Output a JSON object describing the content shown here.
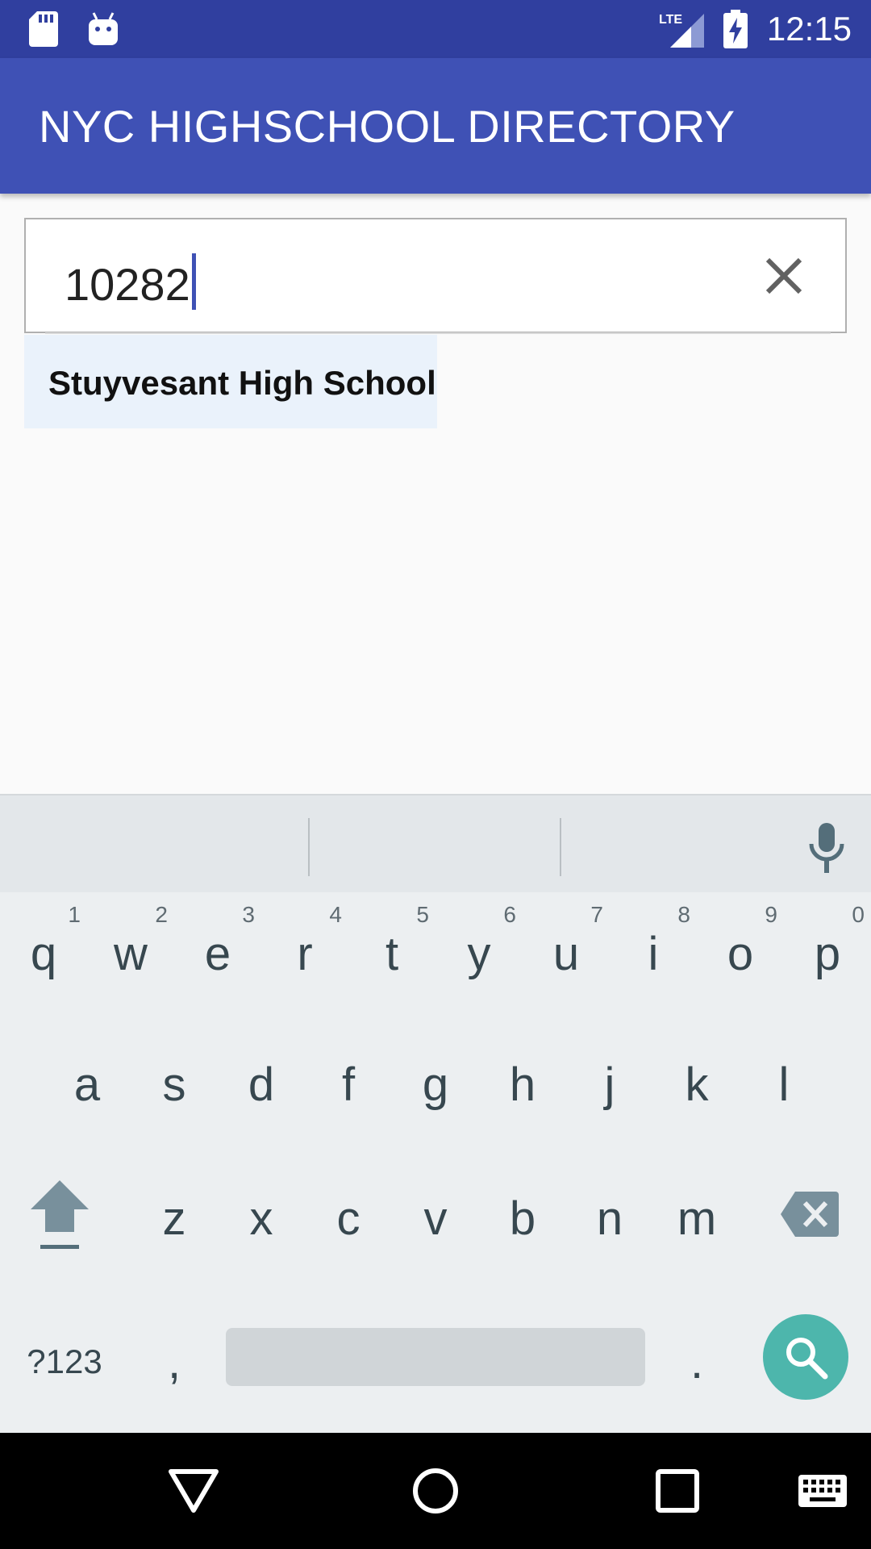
{
  "status_bar": {
    "time": "12:15",
    "network": "LTE",
    "icons": [
      "sd-card-icon",
      "android-icon",
      "lte-signal-icon",
      "battery-charging-icon"
    ]
  },
  "app_bar": {
    "title": "NYC HIGHSCHOOL DIRECTORY",
    "color": "#3f51b5"
  },
  "search": {
    "value": "10282",
    "clear_icon": "close-icon"
  },
  "suggestions": [
    {
      "label": "Stuyvesant High School"
    }
  ],
  "keyboard": {
    "row1": [
      {
        "key": "q",
        "hint": "1"
      },
      {
        "key": "w",
        "hint": "2"
      },
      {
        "key": "e",
        "hint": "3"
      },
      {
        "key": "r",
        "hint": "4"
      },
      {
        "key": "t",
        "hint": "5"
      },
      {
        "key": "y",
        "hint": "6"
      },
      {
        "key": "u",
        "hint": "7"
      },
      {
        "key": "i",
        "hint": "8"
      },
      {
        "key": "o",
        "hint": "9"
      },
      {
        "key": "p",
        "hint": "0"
      }
    ],
    "row2": [
      "a",
      "s",
      "d",
      "f",
      "g",
      "h",
      "j",
      "k",
      "l"
    ],
    "row3": [
      "z",
      "x",
      "c",
      "v",
      "b",
      "n",
      "m"
    ],
    "symbols_key": "?123",
    "comma_key": ",",
    "period_key": ".",
    "action_color": "#4db6ac"
  },
  "nav_bar": {
    "icons": [
      "back-icon",
      "home-icon",
      "recents-icon",
      "keyboard-switch-icon"
    ]
  }
}
